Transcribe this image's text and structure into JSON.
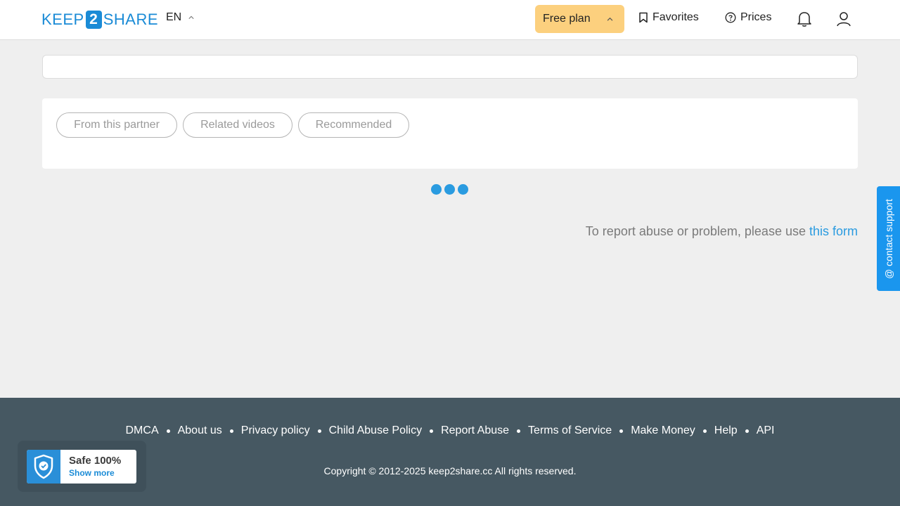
{
  "header": {
    "logo": {
      "part1": "KEEP",
      "part2": "2",
      "part3": "SHARE"
    },
    "language": "EN",
    "plan_label": "Free plan",
    "favorites_label": "Favorites",
    "prices_label": "Prices"
  },
  "tabs": [
    "From this partner",
    "Related videos",
    "Recommended"
  ],
  "report": {
    "text": "To report abuse or problem, please use ",
    "link_text": "this form"
  },
  "support_label": "@ contact support",
  "footer": {
    "links": [
      "DMCA",
      "About us",
      "Privacy policy",
      "Child Abuse Policy",
      "Report Abuse",
      "Terms of Service",
      "Make Money",
      "Help",
      "API"
    ],
    "copyright": "Copyright © 2012-2025 keep2share.cc All rights reserved."
  },
  "safe_badge": {
    "title": "Safe 100%",
    "link": "Show more"
  },
  "colors": {
    "brand": "#1a8bd6",
    "plan_bg": "#fcd07e",
    "footer_bg": "#465862",
    "accent": "#2a9be0"
  }
}
